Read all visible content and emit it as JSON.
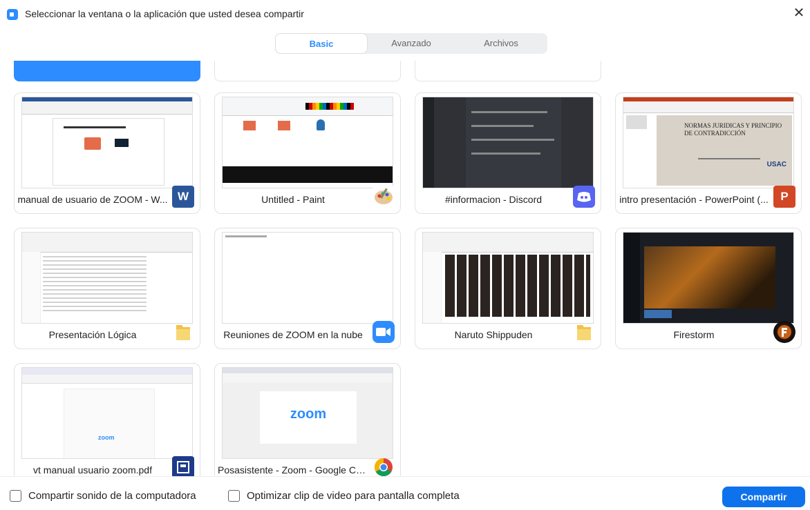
{
  "dialog": {
    "title": "Seleccionar la ventana o la aplicación que usted desea compartir"
  },
  "tabs": [
    {
      "label": "Basic",
      "active": true
    },
    {
      "label": "Avanzado",
      "active": false
    },
    {
      "label": "Archivos",
      "active": false
    }
  ],
  "tiles": [
    {
      "label": "manual de usuario de ZOOM - W...",
      "app_icon": "word-icon"
    },
    {
      "label": "Untitled - Paint",
      "app_icon": "paint-palette-icon"
    },
    {
      "label": "#informacion - Discord",
      "app_icon": "discord-icon"
    },
    {
      "label": "intro presentación - PowerPoint (...",
      "app_icon": "powerpoint-icon"
    },
    {
      "label": "Presentación Lógica",
      "app_icon": "folder-icon"
    },
    {
      "label": "Reuniones de ZOOM en la nube",
      "app_icon": "zoom-icon"
    },
    {
      "label": "Naruto Shippuden",
      "app_icon": "folder-icon"
    },
    {
      "label": "Firestorm",
      "app_icon": "firestorm-icon"
    },
    {
      "label": "vt manual usuario zoom.pdf",
      "app_icon": "pdf-viewer-icon"
    },
    {
      "label": "Posasistente - Zoom - Google Ch...",
      "app_icon": "chrome-icon"
    }
  ],
  "thumbnails": {
    "ppt_slide_title": "NORMAS JURIDICAS Y PRINCIPIO DE CONTRADICCIÓN",
    "ppt_slide_logo": "USAC",
    "chrome_page_logo": "zoom",
    "pdf_page_logo": "zoom"
  },
  "footer": {
    "share_sound_label": "Compartir sonido de la computadora",
    "share_sound_checked": false,
    "optimize_video_label": "Optimizar clip de video para pantalla completa",
    "optimize_video_checked": false,
    "share_button": "Compartir"
  },
  "colors": {
    "accent": "#2d8cff",
    "share_button": "#0e72ed"
  }
}
